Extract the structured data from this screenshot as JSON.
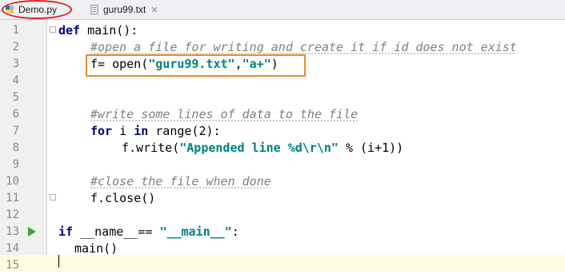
{
  "tabs": [
    {
      "label": "Demo.py",
      "active": true,
      "icon": "python-file-icon"
    },
    {
      "label": "guru99.txt",
      "active": false,
      "icon": "text-file-icon"
    }
  ],
  "colors": {
    "keyword": "#000080",
    "string": "#008080",
    "comment": "#808080",
    "highlight_box": "#e98b2a",
    "active_tab_circle": "#e02020",
    "run_arrow": "#3fa33f"
  },
  "line_numbers": [
    "1",
    "2",
    "3",
    "4",
    "5",
    "6",
    "7",
    "8",
    "9",
    "10",
    "11",
    "12",
    "13",
    "14",
    "15"
  ],
  "code": {
    "l1": {
      "kw": "def",
      "rest": " main():"
    },
    "l2": {
      "comment": "#open a file for writing and create it if id does not exist"
    },
    "l3": {
      "a": "f= open(",
      "s1": "\"guru99.txt\"",
      "b": ",",
      "s2": "\"a+\"",
      "c": ")"
    },
    "l6": {
      "comment": "#write some lines of data to the file"
    },
    "l7": {
      "kw1": "for",
      "a": " i ",
      "kw2": "in",
      "b": " range(2):"
    },
    "l8": {
      "a": "f.write(",
      "s": "\"Appended line %d\\r\\n\"",
      "b": " % (i+1))"
    },
    "l10": {
      "comment": "#close the file when done"
    },
    "l11": {
      "a": "f.close()"
    },
    "l13": {
      "kw": "if",
      "a": " __name__== ",
      "s": "\"__main__\"",
      "b": ":"
    },
    "l14": {
      "a": "main()"
    }
  }
}
